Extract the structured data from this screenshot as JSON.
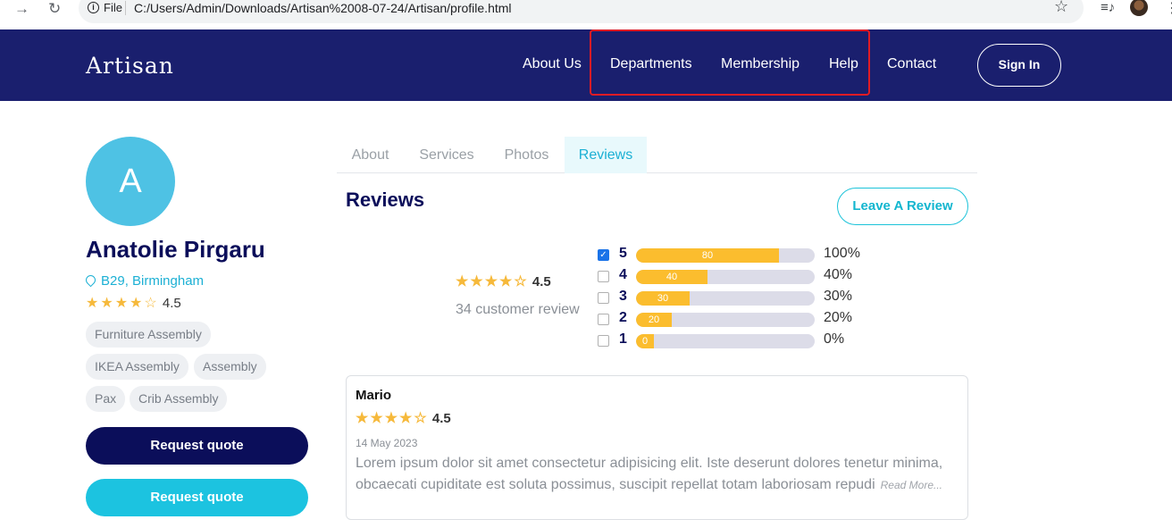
{
  "browser": {
    "back": "→",
    "reload": "↻",
    "file_label": "File",
    "url": "C:/Users/Admin/Downloads/Artisan%2008-07-24/Artisan/profile.html"
  },
  "header": {
    "logo": "Artisan",
    "nav": [
      "About Us",
      "Departments",
      "Membership",
      "Help",
      "Contact"
    ],
    "signin": "Sign In"
  },
  "profile": {
    "initial": "A",
    "name": "Anatolie Pirgaru",
    "location": "B29, Birmingham",
    "rating": "4.5",
    "tags": [
      "Furniture Assembly",
      "IKEA Assembly",
      "Assembly",
      "Pax",
      "Crib Assembly"
    ],
    "request_quote_primary": "Request quote",
    "request_quote_secondary": "Request quote"
  },
  "tabs": [
    "About",
    "Services",
    "Photos",
    "Reviews"
  ],
  "reviews": {
    "title": "Reviews",
    "leave_review": "Leave A Review",
    "average": "4.5",
    "count_text": "34 customer review",
    "breakdown": [
      {
        "stars": "5",
        "bar_label": "80",
        "fill": 0.8,
        "pct": "100%",
        "checked": true
      },
      {
        "stars": "4",
        "bar_label": "40",
        "fill": 0.4,
        "pct": "40%",
        "checked": false
      },
      {
        "stars": "3",
        "bar_label": "30",
        "fill": 0.3,
        "pct": "30%",
        "checked": false
      },
      {
        "stars": "2",
        "bar_label": "20",
        "fill": 0.2,
        "pct": "20%",
        "checked": false
      },
      {
        "stars": "1",
        "bar_label": "0",
        "fill": 0.1,
        "pct": "0%",
        "checked": false
      }
    ],
    "items": [
      {
        "author": "Mario",
        "rating": "4.5",
        "date": "14 May 2023",
        "text": "Lorem ipsum dolor sit amet consectetur adipisicing elit. Iste deserunt dolores tenetur minima, obcaecati cupiditate est soluta possimus, suscipit repellat totam laboriosam repudi",
        "read_more": "Read More..."
      }
    ]
  },
  "colors": {
    "header_bg": "#1a1f6e",
    "accent": "#1cb0d4",
    "star": "#f6b93b",
    "bar_fill": "#fbbd2e",
    "primary_btn": "#0b0e5a",
    "secondary_btn": "#1cc3e0"
  }
}
